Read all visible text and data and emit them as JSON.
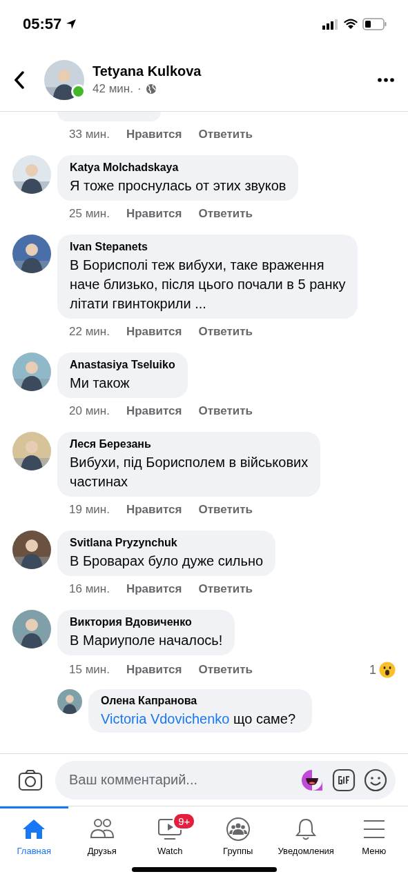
{
  "status_bar": {
    "time": "05:57"
  },
  "header": {
    "name": "Tetyana Kulkova",
    "online": true,
    "time": "42 мин.",
    "separator": "·"
  },
  "top_fragment": {
    "time": "33 мин.",
    "like": "Нравится",
    "reply": "Ответить"
  },
  "comments": [
    {
      "author": "Katya Molchadskaya",
      "text": "Я тоже проснулась от этих звуков",
      "time": "25 мин.",
      "like": "Нравится",
      "reply": "Ответить"
    },
    {
      "author": "Ivan Stepanets",
      "text": "В Борисполі теж вибухи, таке враження\nначе близько, після цього почали в 5 ранку\nлітати гвинтокрили ...",
      "time": "22 мин.",
      "like": "Нравится",
      "reply": "Ответить"
    },
    {
      "author": "Anastasiya Tseluiko",
      "text": "Ми також",
      "time": "20 мин.",
      "like": "Нравится",
      "reply": "Ответить"
    },
    {
      "author": "Леся Березань",
      "text": "Вибухи, під Борисполем в військових\nчастинах",
      "time": "19 мин.",
      "like": "Нравится",
      "reply": "Ответить"
    },
    {
      "author": "Svitlana Pryzynchuk",
      "text": "В Броварах було дуже сильно",
      "time": "16 мин.",
      "like": "Нравится",
      "reply": "Ответить"
    },
    {
      "author": "Виктория Вдовиченко",
      "text": "В Мариуполе началось!",
      "time": "15 мин.",
      "like": "Нравится",
      "reply": "Ответить",
      "reaction_count": "1",
      "replies": [
        {
          "author": "Олена Капранова",
          "mention": "Victoria Vdovichenko",
          "text": "що саме?"
        }
      ]
    }
  ],
  "composer": {
    "placeholder": "Ваш комментарий..."
  },
  "tabs": [
    {
      "label": "Главная",
      "selected": true
    },
    {
      "label": "Друзья",
      "selected": false
    },
    {
      "label": "Watch",
      "selected": false,
      "badge": "9+"
    },
    {
      "label": "Группы",
      "selected": false
    },
    {
      "label": "Уведомления",
      "selected": false
    },
    {
      "label": "Меню",
      "selected": false
    }
  ]
}
